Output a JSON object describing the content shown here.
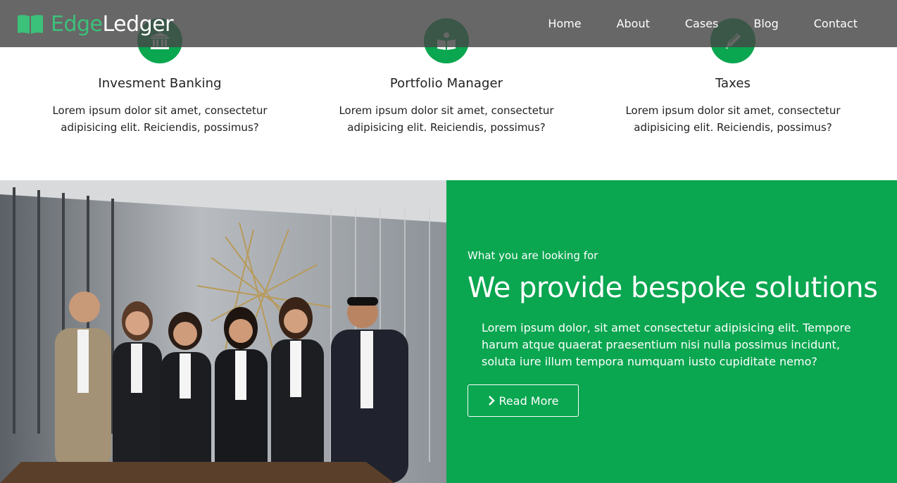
{
  "brand": {
    "edge": "Edge",
    "ledger": "Ledger",
    "green": "#3cc17a"
  },
  "nav": {
    "items": [
      {
        "label": "Home"
      },
      {
        "label": "About"
      },
      {
        "label": "Cases"
      },
      {
        "label": "Blog"
      },
      {
        "label": "Contact"
      }
    ]
  },
  "services": [
    {
      "icon": "bank-icon",
      "title": "Invesment Banking",
      "text_line1": "Lorem ipsum dolor sit amet, consectetur",
      "text_line2": "adipisicing elit. Reiciendis, possimus?"
    },
    {
      "icon": "book-reader-icon",
      "title": "Portfolio Manager",
      "text_line1": "Lorem ipsum dolor sit amet, consectetur",
      "text_line2": "adipisicing elit. Reiciendis, possimus?"
    },
    {
      "icon": "pencil-icon",
      "title": "Taxes",
      "text_line1": "Lorem ipsum dolor sit amet, consectetur",
      "text_line2": "adipisicing elit. Reiciendis, possimus?"
    }
  ],
  "feature": {
    "eyebrow": "What you are looking for",
    "headline": "We provide bespoke solutions",
    "body": "Lorem ipsum dolor, sit amet consectetur adipisicing elit. Tempore harum atque quaerat praesentium nisi nulla possimus incidunt, soluta iure illum tempora numquam iusto cupiditate nemo?",
    "button_label": "Read More",
    "button_icon": "chevron-right-icon",
    "photo": "team-photo"
  },
  "colors": {
    "accent": "#0aa650",
    "header_bg": "#464646"
  }
}
